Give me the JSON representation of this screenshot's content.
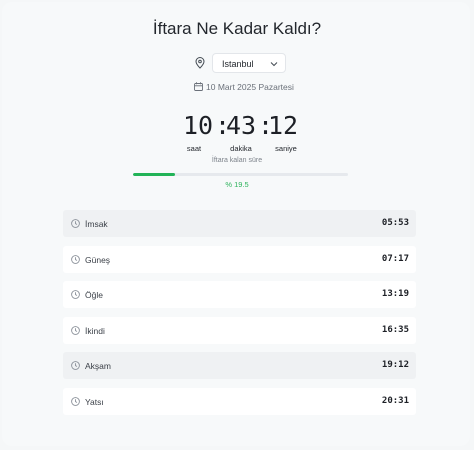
{
  "title": "İftara Ne Kadar Kaldı?",
  "location": {
    "city": "Istanbul"
  },
  "date": "10 Mart 2025 Pazartesi",
  "countdown": {
    "hours": "10",
    "minutes": "43",
    "seconds": "12",
    "separator": ":",
    "hours_label": "saat",
    "minutes_label": "dakika",
    "seconds_label": "saniye",
    "caption": "İftara kalan süre"
  },
  "progress": {
    "percent": 19.5,
    "label": "% 19.5"
  },
  "colors": {
    "accent": "#22b357",
    "highlight_row": "#eff1f3"
  },
  "prayer_times": [
    {
      "name": "İmsak",
      "time": "05:53",
      "highlighted": true
    },
    {
      "name": "Güneş",
      "time": "07:17",
      "highlighted": false
    },
    {
      "name": "Öğle",
      "time": "13:19",
      "highlighted": false
    },
    {
      "name": "İkindi",
      "time": "16:35",
      "highlighted": false
    },
    {
      "name": "Akşam",
      "time": "19:12",
      "highlighted": true
    },
    {
      "name": "Yatsı",
      "time": "20:31",
      "highlighted": false
    }
  ]
}
